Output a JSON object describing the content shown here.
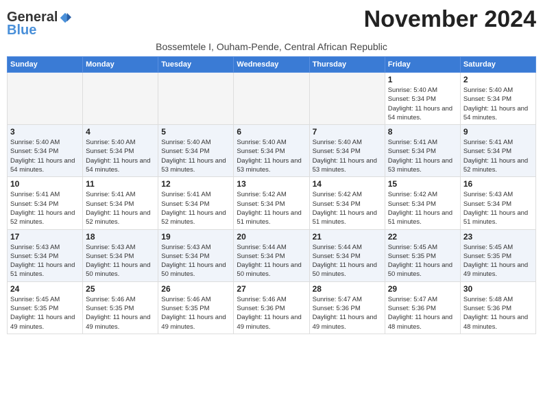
{
  "logo": {
    "general": "General",
    "blue": "Blue"
  },
  "title": "November 2024",
  "subtitle": "Bossemtele I, Ouham-Pende, Central African Republic",
  "days_of_week": [
    "Sunday",
    "Monday",
    "Tuesday",
    "Wednesday",
    "Thursday",
    "Friday",
    "Saturday"
  ],
  "weeks": [
    [
      {
        "day": "",
        "empty": true
      },
      {
        "day": "",
        "empty": true
      },
      {
        "day": "",
        "empty": true
      },
      {
        "day": "",
        "empty": true
      },
      {
        "day": "",
        "empty": true
      },
      {
        "day": "1",
        "sunrise": "Sunrise: 5:40 AM",
        "sunset": "Sunset: 5:34 PM",
        "daylight": "Daylight: 11 hours and 54 minutes."
      },
      {
        "day": "2",
        "sunrise": "Sunrise: 5:40 AM",
        "sunset": "Sunset: 5:34 PM",
        "daylight": "Daylight: 11 hours and 54 minutes."
      }
    ],
    [
      {
        "day": "3",
        "sunrise": "Sunrise: 5:40 AM",
        "sunset": "Sunset: 5:34 PM",
        "daylight": "Daylight: 11 hours and 54 minutes."
      },
      {
        "day": "4",
        "sunrise": "Sunrise: 5:40 AM",
        "sunset": "Sunset: 5:34 PM",
        "daylight": "Daylight: 11 hours and 54 minutes."
      },
      {
        "day": "5",
        "sunrise": "Sunrise: 5:40 AM",
        "sunset": "Sunset: 5:34 PM",
        "daylight": "Daylight: 11 hours and 53 minutes."
      },
      {
        "day": "6",
        "sunrise": "Sunrise: 5:40 AM",
        "sunset": "Sunset: 5:34 PM",
        "daylight": "Daylight: 11 hours and 53 minutes."
      },
      {
        "day": "7",
        "sunrise": "Sunrise: 5:40 AM",
        "sunset": "Sunset: 5:34 PM",
        "daylight": "Daylight: 11 hours and 53 minutes."
      },
      {
        "day": "8",
        "sunrise": "Sunrise: 5:41 AM",
        "sunset": "Sunset: 5:34 PM",
        "daylight": "Daylight: 11 hours and 53 minutes."
      },
      {
        "day": "9",
        "sunrise": "Sunrise: 5:41 AM",
        "sunset": "Sunset: 5:34 PM",
        "daylight": "Daylight: 11 hours and 52 minutes."
      }
    ],
    [
      {
        "day": "10",
        "sunrise": "Sunrise: 5:41 AM",
        "sunset": "Sunset: 5:34 PM",
        "daylight": "Daylight: 11 hours and 52 minutes."
      },
      {
        "day": "11",
        "sunrise": "Sunrise: 5:41 AM",
        "sunset": "Sunset: 5:34 PM",
        "daylight": "Daylight: 11 hours and 52 minutes."
      },
      {
        "day": "12",
        "sunrise": "Sunrise: 5:41 AM",
        "sunset": "Sunset: 5:34 PM",
        "daylight": "Daylight: 11 hours and 52 minutes."
      },
      {
        "day": "13",
        "sunrise": "Sunrise: 5:42 AM",
        "sunset": "Sunset: 5:34 PM",
        "daylight": "Daylight: 11 hours and 51 minutes."
      },
      {
        "day": "14",
        "sunrise": "Sunrise: 5:42 AM",
        "sunset": "Sunset: 5:34 PM",
        "daylight": "Daylight: 11 hours and 51 minutes."
      },
      {
        "day": "15",
        "sunrise": "Sunrise: 5:42 AM",
        "sunset": "Sunset: 5:34 PM",
        "daylight": "Daylight: 11 hours and 51 minutes."
      },
      {
        "day": "16",
        "sunrise": "Sunrise: 5:43 AM",
        "sunset": "Sunset: 5:34 PM",
        "daylight": "Daylight: 11 hours and 51 minutes."
      }
    ],
    [
      {
        "day": "17",
        "sunrise": "Sunrise: 5:43 AM",
        "sunset": "Sunset: 5:34 PM",
        "daylight": "Daylight: 11 hours and 51 minutes."
      },
      {
        "day": "18",
        "sunrise": "Sunrise: 5:43 AM",
        "sunset": "Sunset: 5:34 PM",
        "daylight": "Daylight: 11 hours and 50 minutes."
      },
      {
        "day": "19",
        "sunrise": "Sunrise: 5:43 AM",
        "sunset": "Sunset: 5:34 PM",
        "daylight": "Daylight: 11 hours and 50 minutes."
      },
      {
        "day": "20",
        "sunrise": "Sunrise: 5:44 AM",
        "sunset": "Sunset: 5:34 PM",
        "daylight": "Daylight: 11 hours and 50 minutes."
      },
      {
        "day": "21",
        "sunrise": "Sunrise: 5:44 AM",
        "sunset": "Sunset: 5:34 PM",
        "daylight": "Daylight: 11 hours and 50 minutes."
      },
      {
        "day": "22",
        "sunrise": "Sunrise: 5:45 AM",
        "sunset": "Sunset: 5:35 PM",
        "daylight": "Daylight: 11 hours and 50 minutes."
      },
      {
        "day": "23",
        "sunrise": "Sunrise: 5:45 AM",
        "sunset": "Sunset: 5:35 PM",
        "daylight": "Daylight: 11 hours and 49 minutes."
      }
    ],
    [
      {
        "day": "24",
        "sunrise": "Sunrise: 5:45 AM",
        "sunset": "Sunset: 5:35 PM",
        "daylight": "Daylight: 11 hours and 49 minutes."
      },
      {
        "day": "25",
        "sunrise": "Sunrise: 5:46 AM",
        "sunset": "Sunset: 5:35 PM",
        "daylight": "Daylight: 11 hours and 49 minutes."
      },
      {
        "day": "26",
        "sunrise": "Sunrise: 5:46 AM",
        "sunset": "Sunset: 5:35 PM",
        "daylight": "Daylight: 11 hours and 49 minutes."
      },
      {
        "day": "27",
        "sunrise": "Sunrise: 5:46 AM",
        "sunset": "Sunset: 5:36 PM",
        "daylight": "Daylight: 11 hours and 49 minutes."
      },
      {
        "day": "28",
        "sunrise": "Sunrise: 5:47 AM",
        "sunset": "Sunset: 5:36 PM",
        "daylight": "Daylight: 11 hours and 49 minutes."
      },
      {
        "day": "29",
        "sunrise": "Sunrise: 5:47 AM",
        "sunset": "Sunset: 5:36 PM",
        "daylight": "Daylight: 11 hours and 48 minutes."
      },
      {
        "day": "30",
        "sunrise": "Sunrise: 5:48 AM",
        "sunset": "Sunset: 5:36 PM",
        "daylight": "Daylight: 11 hours and 48 minutes."
      }
    ]
  ]
}
